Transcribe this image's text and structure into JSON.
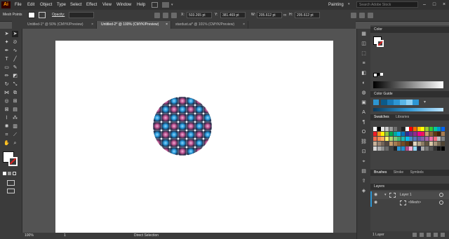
{
  "app": {
    "logo": "Ai"
  },
  "menu": [
    "File",
    "Edit",
    "Object",
    "Type",
    "Select",
    "Effect",
    "View",
    "Window",
    "Help"
  ],
  "workspace": "Painting",
  "search": {
    "placeholder": "Search Adobe Stock"
  },
  "control_bar": {
    "tool_label": "Mesh Points",
    "opacity_label": "Opacity:",
    "x_label": "X:",
    "x_value": "503.265 pt",
    "y_label": "Y:",
    "y_value": "381.469 pt",
    "w_label": "W:",
    "w_value": "205.612 pt",
    "h_label": "H:",
    "h_value": "205.612 pt"
  },
  "tabs": [
    {
      "label": "Untitled-1* @ 50% (CMYK/Preview)",
      "close": "×"
    },
    {
      "label": "Untitled-2* @ 100% (CMYK/Preview)",
      "close": "×"
    },
    {
      "label": "stardust.ai* @ 101% (CMYK/Preview)",
      "close": "×"
    }
  ],
  "panels": {
    "color": "Color",
    "color_guide": "Color Guide",
    "swatches": "Swatches",
    "libraries": "Libraries",
    "brushes": "Brushes",
    "stroke": "Stroke",
    "symbols": "Symbols",
    "layers": "Layers",
    "layer1": "Layer 1",
    "mesh": "<Mesh>",
    "layer_count": "1 Layer"
  },
  "status": {
    "zoom": "100%",
    "page": "1",
    "tool": "Direct Selection"
  },
  "colors": {
    "accent": "#2d96d3",
    "mesh_dark": "#1c2540",
    "mesh_pink": "#b04a86",
    "mesh_blue": "#1f8fd0"
  }
}
